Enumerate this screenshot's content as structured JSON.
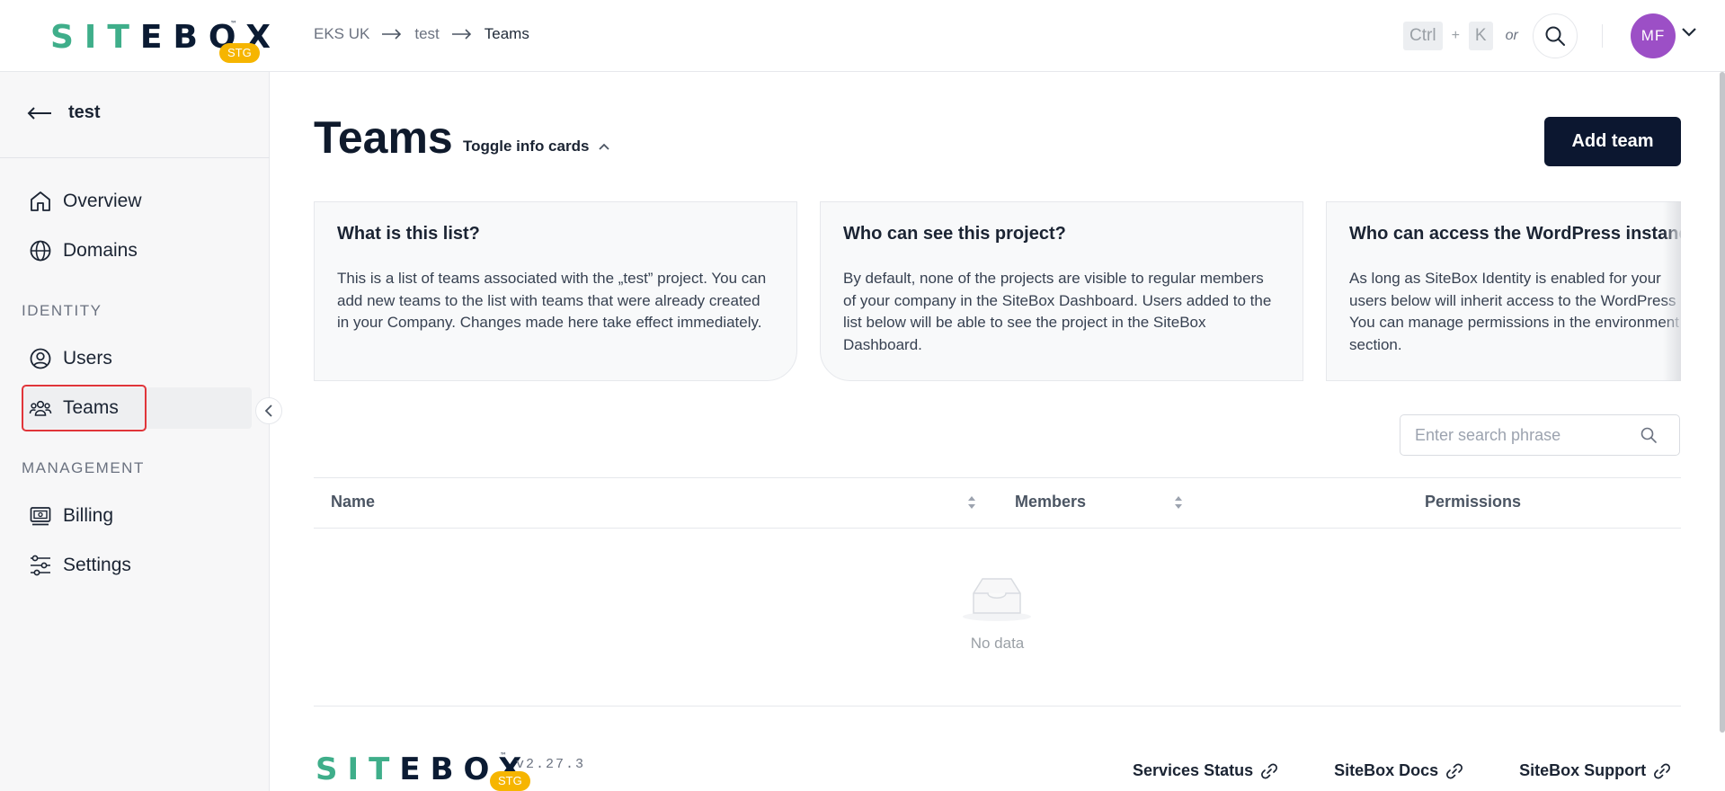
{
  "header": {
    "logo_text_a": "SIT",
    "logo_text_b": "E",
    "logo_text_c": "BOX",
    "logo_tm": "™",
    "logo_badge": "STG",
    "breadcrumb": [
      "EKS UK",
      "test",
      "Teams"
    ],
    "shortcut": {
      "key1": "Ctrl",
      "plus": "+",
      "key2": "K",
      "or": "or"
    },
    "avatar_initials": "MF"
  },
  "sidebar": {
    "back_label": "test",
    "items_top": [
      {
        "label": "Overview",
        "icon": "home-icon"
      },
      {
        "label": "Domains",
        "icon": "globe-icon"
      }
    ],
    "section_identity": "IDENTITY",
    "items_identity": [
      {
        "label": "Users",
        "icon": "user-circle-icon"
      },
      {
        "label": "Teams",
        "icon": "team-icon",
        "active": true
      }
    ],
    "section_management": "MANAGEMENT",
    "items_management": [
      {
        "label": "Billing",
        "icon": "billing-icon"
      },
      {
        "label": "Settings",
        "icon": "sliders-icon"
      }
    ]
  },
  "main": {
    "title": "Teams",
    "toggle_label": "Toggle info cards",
    "add_button": "Add team",
    "cards": [
      {
        "title": "What is this list?",
        "text": "This is a list of teams associated with the „test” project. You can add new teams to the list with teams that were already created in your Company. Changes made here take effect immediately."
      },
      {
        "title": "Who can see this project?",
        "text": "By default, none of the projects are visible to regular members of your company in the SiteBox Dashboard. Users added to the list below will be able to see the project in the SiteBox Dashboard."
      },
      {
        "title": "Who can access the WordPress instance",
        "line1": "As long as SiteBox Identity is enabled for your",
        "line2": "users below will inherit access to the WordPress",
        "line3": "You can manage permissions in the environment",
        "line4": "section."
      }
    ],
    "search_placeholder": "Enter search phrase",
    "table": {
      "columns": [
        "Name",
        "Members",
        "Permissions"
      ],
      "empty_text": "No data"
    }
  },
  "footer": {
    "logo_badge": "STG",
    "version": "v2.27.3",
    "links": [
      "Services Status",
      "SiteBox Docs",
      "SiteBox Support"
    ]
  }
}
